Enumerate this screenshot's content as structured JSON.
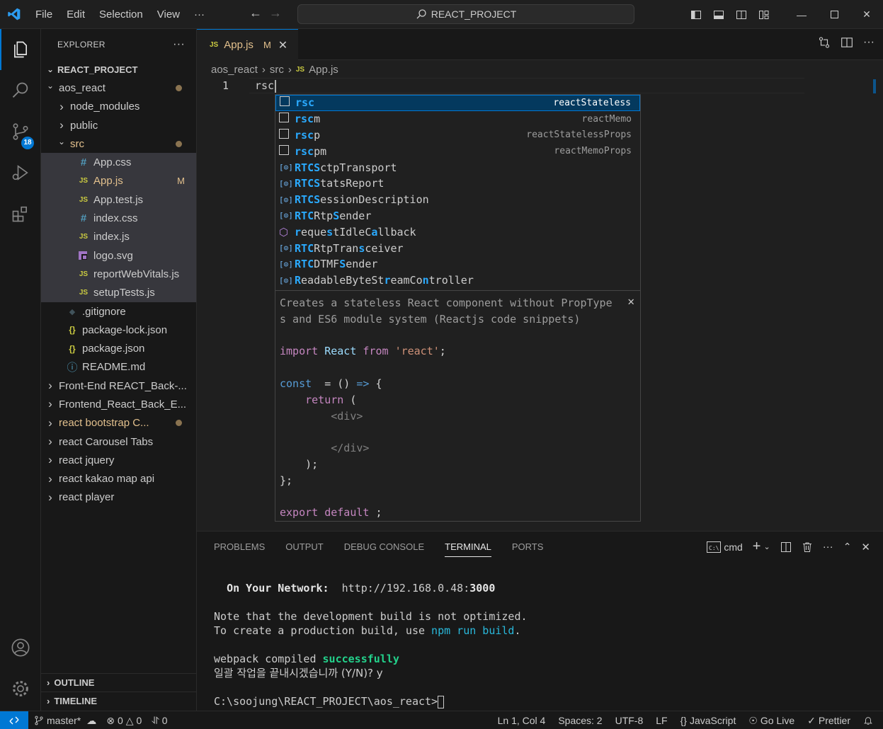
{
  "titlebar": {
    "menu": [
      "File",
      "Edit",
      "Selection",
      "View",
      "···"
    ],
    "search_text": "REACT_PROJECT"
  },
  "activity": {
    "scm_badge": "18"
  },
  "explorer": {
    "header": "EXPLORER",
    "root": "REACT_PROJECT",
    "items": [
      {
        "label": "aos_react",
        "indent": 1,
        "chev": "v",
        "icon": "",
        "deco": "dot"
      },
      {
        "label": "node_modules",
        "indent": 2,
        "chev": ">",
        "icon": "",
        "deco": ""
      },
      {
        "label": "public",
        "indent": 2,
        "chev": ">",
        "icon": "",
        "deco": ""
      },
      {
        "label": "src",
        "indent": 2,
        "chev": "v",
        "icon": "",
        "deco": "dot",
        "modified": true
      },
      {
        "label": "App.css",
        "indent": 3,
        "chev": "",
        "icon": "#",
        "iconcls": "css",
        "deco": "",
        "sel": true
      },
      {
        "label": "App.js",
        "indent": 3,
        "chev": "",
        "icon": "JS",
        "iconcls": "js",
        "deco": "M",
        "sel": true,
        "modified": true
      },
      {
        "label": "App.test.js",
        "indent": 3,
        "chev": "",
        "icon": "JS",
        "iconcls": "js",
        "deco": "",
        "sel": true
      },
      {
        "label": "index.css",
        "indent": 3,
        "chev": "",
        "icon": "#",
        "iconcls": "css",
        "deco": "",
        "sel": true
      },
      {
        "label": "index.js",
        "indent": 3,
        "chev": "",
        "icon": "JS",
        "iconcls": "js",
        "deco": "",
        "sel": true
      },
      {
        "label": "logo.svg",
        "indent": 3,
        "chev": "",
        "icon": "svg",
        "iconcls": "svgi",
        "deco": "",
        "sel": true
      },
      {
        "label": "reportWebVitals.js",
        "indent": 3,
        "chev": "",
        "icon": "JS",
        "iconcls": "js",
        "deco": "",
        "sel": true
      },
      {
        "label": "setupTests.js",
        "indent": 3,
        "chev": "",
        "icon": "JS",
        "iconcls": "js",
        "deco": "",
        "sel": true
      },
      {
        "label": ".gitignore",
        "indent": 2,
        "chev": "",
        "icon": "◆",
        "iconcls": "git",
        "deco": ""
      },
      {
        "label": "package-lock.json",
        "indent": 2,
        "chev": "",
        "icon": "{}",
        "iconcls": "json",
        "deco": ""
      },
      {
        "label": "package.json",
        "indent": 2,
        "chev": "",
        "icon": "{}",
        "iconcls": "json",
        "deco": ""
      },
      {
        "label": "README.md",
        "indent": 2,
        "chev": "",
        "icon": "ⓘ",
        "iconcls": "info",
        "deco": ""
      },
      {
        "label": "Front-End REACT_Back-...",
        "indent": 1,
        "chev": ">",
        "icon": "",
        "deco": ""
      },
      {
        "label": "Frontend_React_Back_E...",
        "indent": 1,
        "chev": ">",
        "icon": "",
        "deco": ""
      },
      {
        "label": "react bootstrap C...",
        "indent": 1,
        "chev": ">",
        "icon": "",
        "deco": "dot",
        "modified": true
      },
      {
        "label": "react Carousel Tabs",
        "indent": 1,
        "chev": ">",
        "icon": "",
        "deco": ""
      },
      {
        "label": "react jquery",
        "indent": 1,
        "chev": ">",
        "icon": "",
        "deco": ""
      },
      {
        "label": "react kakao map api",
        "indent": 1,
        "chev": ">",
        "icon": "",
        "deco": ""
      },
      {
        "label": "react player",
        "indent": 1,
        "chev": ">",
        "icon": "",
        "deco": ""
      }
    ],
    "outline": "OUTLINE",
    "timeline": "TIMELINE"
  },
  "tab": {
    "icon": "JS",
    "label": "App.js",
    "status": "M"
  },
  "breadcrumb": [
    "aos_react",
    "src",
    "App.js"
  ],
  "editor": {
    "line_number": "1",
    "code": "rsc"
  },
  "suggest": [
    {
      "icon": "snippet",
      "pre": "",
      "hl": "rsc",
      "post": "",
      "detail": "reactStateless"
    },
    {
      "icon": "snippet",
      "pre": "",
      "hl": "rsc",
      "post": "m",
      "detail": "reactMemo"
    },
    {
      "icon": "snippet",
      "pre": "",
      "hl": "rsc",
      "post": "p",
      "detail": "reactStatelessProps"
    },
    {
      "icon": "snippet",
      "pre": "",
      "hl": "rsc",
      "post": "pm",
      "detail": "reactMemoProps"
    },
    {
      "icon": "var",
      "label": "RTCSctpTransport",
      "detail": ""
    },
    {
      "icon": "var",
      "label": "RTCStatsReport",
      "detail": ""
    },
    {
      "icon": "var",
      "label": "RTCSessionDescription",
      "detail": ""
    },
    {
      "icon": "var",
      "label": "RTCRtpSender",
      "detail": ""
    },
    {
      "icon": "cube",
      "label": "requestIdleCallback",
      "detail": ""
    },
    {
      "icon": "var",
      "label": "RTCRtpTransceiver",
      "detail": ""
    },
    {
      "icon": "var",
      "label": "RTCDTMFSender",
      "detail": ""
    },
    {
      "icon": "var",
      "label": "ReadableByteStreamController",
      "detail": ""
    }
  ],
  "details": {
    "desc1": "Creates a stateless React component without PropType",
    "desc2": "s and ES6 module system (Reactjs code snippets)"
  },
  "panel": {
    "tabs": [
      "PROBLEMS",
      "OUTPUT",
      "DEBUG CONSOLE",
      "TERMINAL",
      "PORTS"
    ],
    "active_tab": "TERMINAL",
    "shell": "cmd"
  },
  "terminal": {
    "net_label": "On Your Network:",
    "net_url": "http://192.168.0.48:",
    "net_port": "3000",
    "note1": "Note that the development build is not optimized.",
    "note2a": "To create a production build, use ",
    "note2b": "npm run build",
    "note2c": ".",
    "webpack_a": "webpack compiled ",
    "webpack_b": "successfully",
    "korean": "일괄 작업을 끝내시겠습니까 (Y/N)? y",
    "prompt": "C:\\soojung\\REACT_PROJECT\\aos_react>"
  },
  "status": {
    "branch": "master*",
    "errors": "0",
    "warnings": "0",
    "ports": "0",
    "position": "Ln 1, Col 4",
    "spaces": "Spaces: 2",
    "encoding": "UTF-8",
    "eol": "LF",
    "language": "JavaScript",
    "golive": "Go Live",
    "prettier": "Prettier"
  }
}
